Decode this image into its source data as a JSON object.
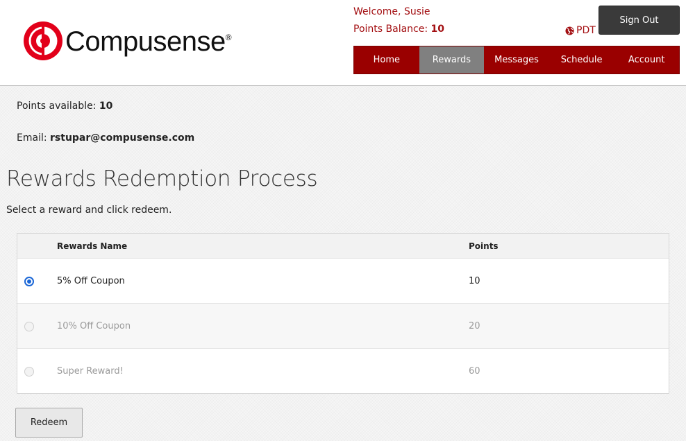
{
  "brand": {
    "name": "Compusense",
    "registered_mark": "®",
    "color": "#e2001a"
  },
  "header": {
    "welcome": "Welcome, Susie",
    "points_balance_label": "Points Balance:",
    "points_balance_value": "10",
    "timezone": "PDT",
    "timezone_icon": "globe-icon",
    "sign_out_label": "Sign Out"
  },
  "nav": {
    "items": [
      {
        "label": "Home",
        "active": false
      },
      {
        "label": "Rewards",
        "active": true
      },
      {
        "label": "Messages",
        "active": false
      },
      {
        "label": "Schedule",
        "active": false
      },
      {
        "label": "Account",
        "active": false
      }
    ]
  },
  "account": {
    "points_available_label": "Points available:",
    "points_available_value": "10",
    "email_label": "Email:",
    "email_value": "rstupar@compusense.com"
  },
  "main": {
    "title": "Rewards Redemption Process",
    "instructions": "Select a reward and click redeem.",
    "table": {
      "columns": [
        "Rewards Name",
        "Points"
      ],
      "rows": [
        {
          "name": "5% Off Coupon",
          "points": "10",
          "selected": true,
          "enabled": true
        },
        {
          "name": "10% Off Coupon",
          "points": "20",
          "selected": false,
          "enabled": false
        },
        {
          "name": "Super Reward!",
          "points": "60",
          "selected": false,
          "enabled": false
        }
      ]
    },
    "redeem_label": "Redeem"
  },
  "colors": {
    "accent": "#a30f12",
    "nav_bg": "#9a0000",
    "nav_active": "#808080",
    "radio_selected": "#1a66d6"
  }
}
